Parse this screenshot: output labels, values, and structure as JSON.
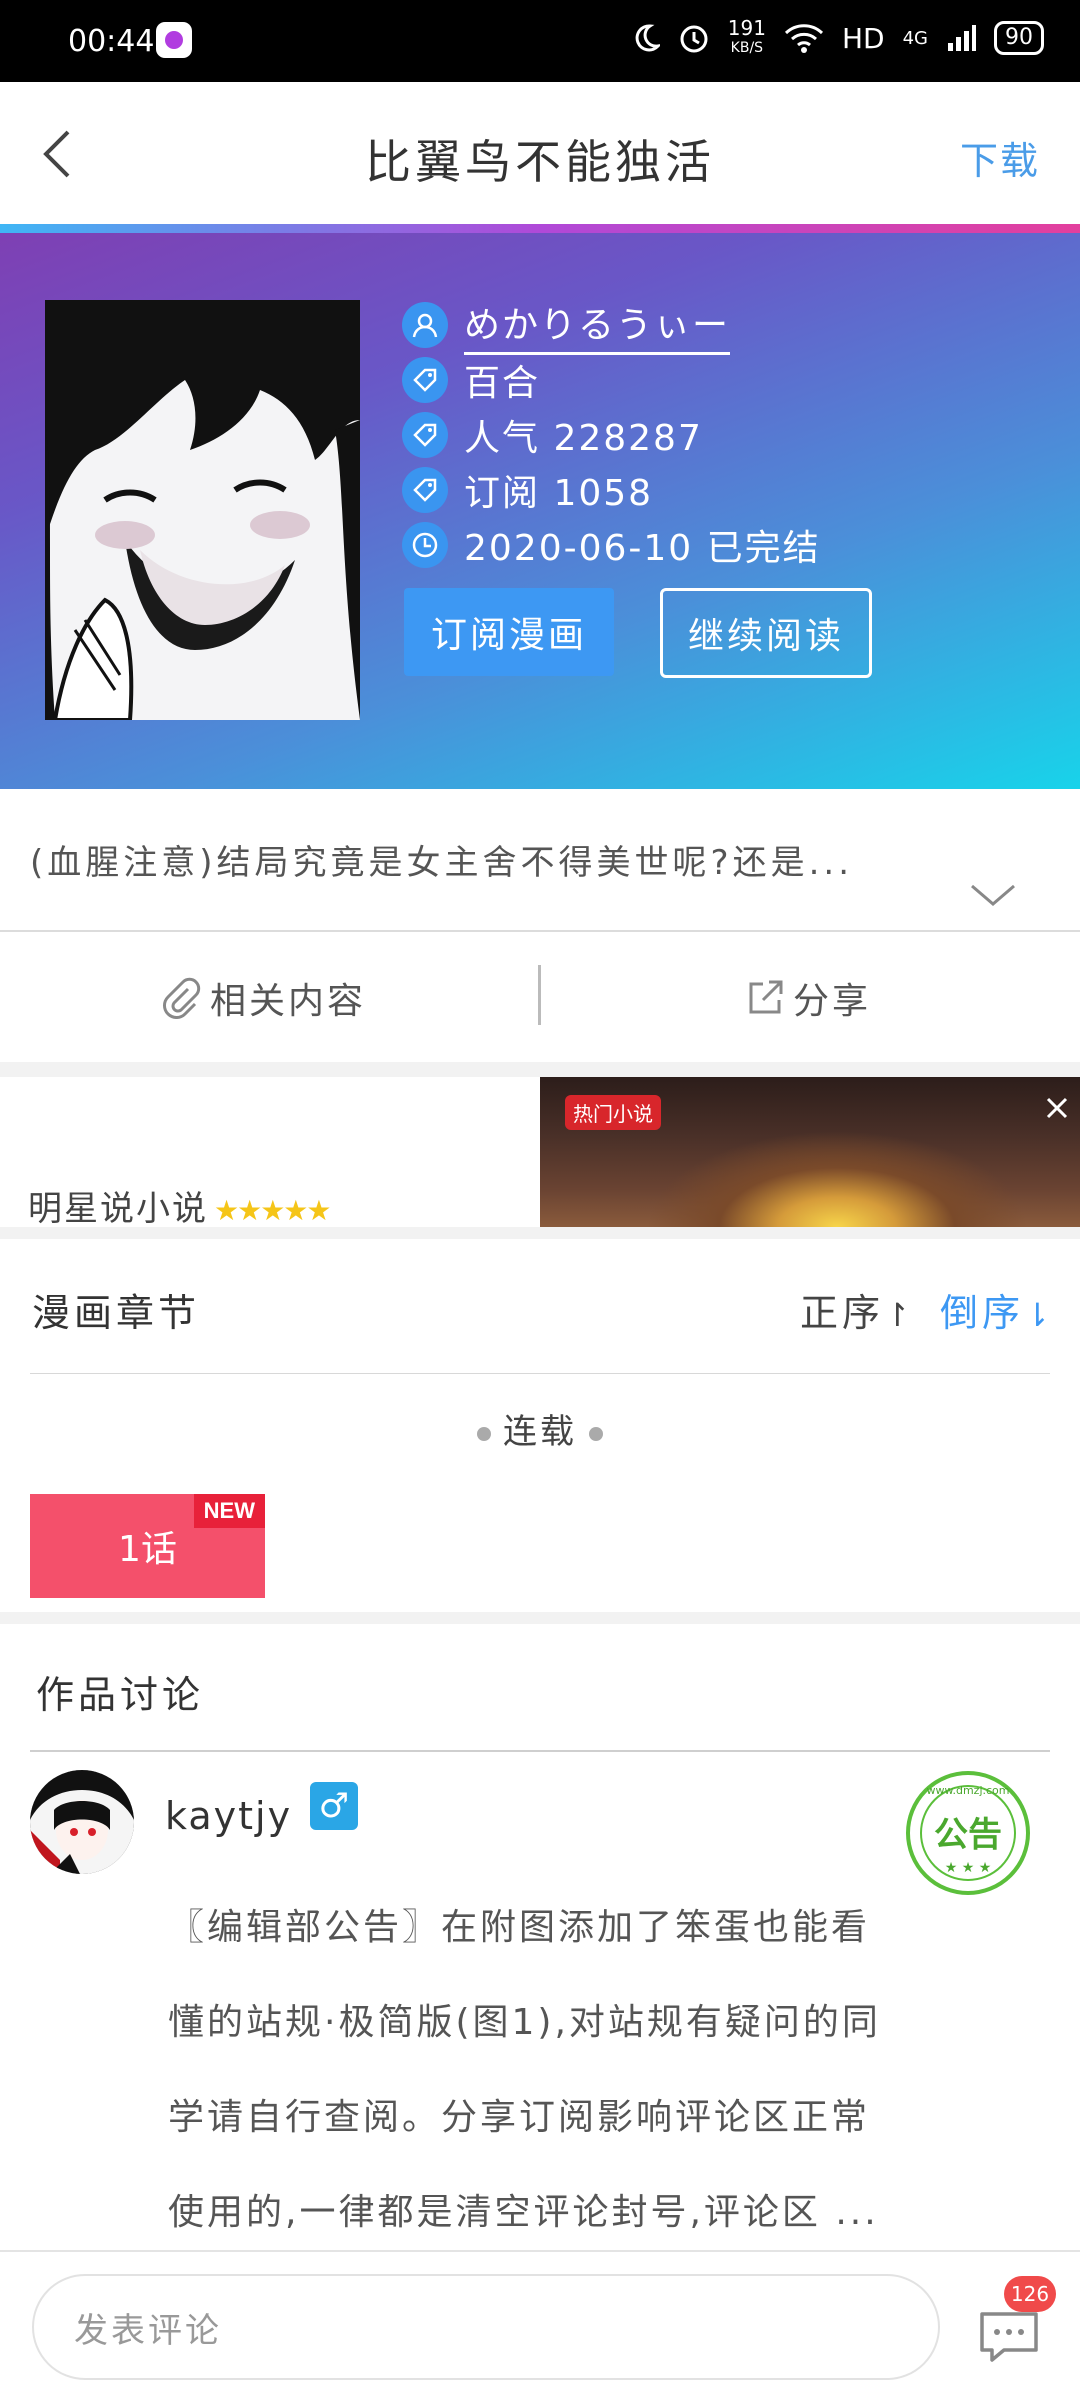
{
  "status": {
    "time": "00:44",
    "speed_value": "191",
    "speed_unit": "KB/S",
    "network": "HD",
    "signal": "4G",
    "battery": "90"
  },
  "nav": {
    "title": "比翼鸟不能独活",
    "download": "下载"
  },
  "comic": {
    "author": "めかりるうぃー",
    "genre": "百合",
    "popularity": "人气 228287",
    "subscriptions": "订阅 1058",
    "status_date": "2020-06-10 已完结",
    "subscribe_btn": "订阅漫画",
    "continue_btn": "继续阅读",
    "description": "(血腥注意)结局究竟是女主舍不得美世呢?还是..."
  },
  "actions": {
    "related": "相关内容",
    "share": "分享"
  },
  "ad": {
    "title": "明星说小说",
    "stars": "★★★★★",
    "tag": "热门小说"
  },
  "chapters": {
    "title": "漫画章节",
    "order_asc": "正序",
    "order_desc": "倒序",
    "ongoing": "连载",
    "items": [
      {
        "label": "1话",
        "badge": "NEW"
      }
    ]
  },
  "discussion": {
    "title": "作品讨论",
    "user": "kaytjy",
    "gender": "♂",
    "stamp_text": "公告",
    "stamp_url": "www.dmzj.com",
    "lines": [
      "〖编辑部公告〗在附图添加了笨蛋也能看",
      "懂的站规·极简版(图1),对站规有疑问的同",
      "学请自行查阅。分享订阅影响评论区正常",
      "使用的,一律都是清空评论封号,评论区 ..."
    ]
  },
  "bottom": {
    "input_placeholder": "发表评论",
    "message_count": "126"
  },
  "colors": {
    "accent": "#3d98f3",
    "chapter": "#f4506b",
    "new_badge": "#e8213a"
  }
}
